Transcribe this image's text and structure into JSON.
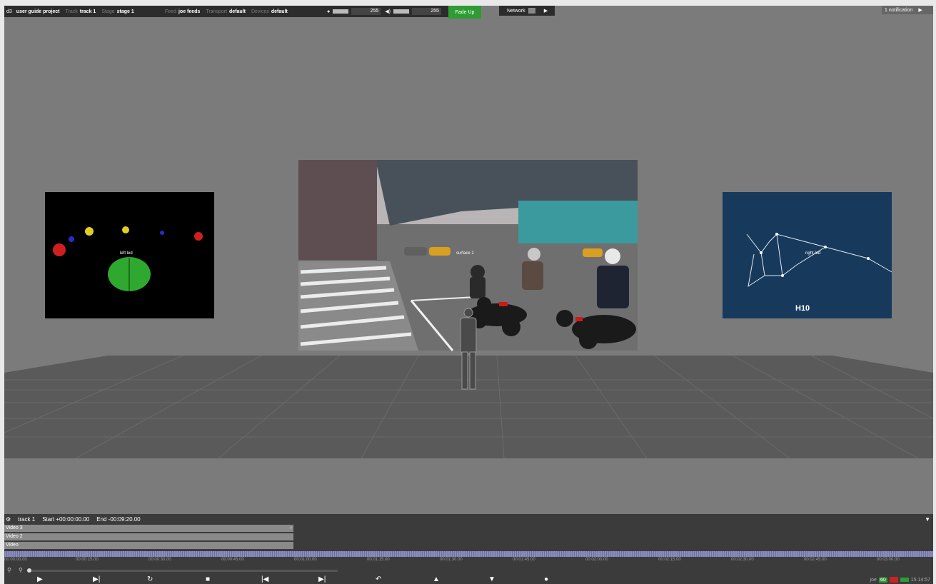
{
  "app": {
    "logo": "d3"
  },
  "topbar": {
    "project": "user guide project",
    "track_label": "Track",
    "track_value": "track 1",
    "stage_label": "Stage",
    "stage_value": "stage 1",
    "feed_label": "Feed",
    "feed_value": "joe feeds",
    "transport_label": "Transport",
    "transport_value": "default",
    "devices_label": "Devices",
    "devices_value": "default",
    "brightness_value": "255",
    "volume_value": "255",
    "fade_up": "Fade Up",
    "network": "Network",
    "notifications": "1 notification"
  },
  "stage": {
    "left_screen_label": "left led",
    "center_screen_label": "surface 1",
    "right_screen_label": "right led",
    "right_screen_caption": "H10"
  },
  "timeline": {
    "track_name": "track 1",
    "start": "Start +00:00:00.00",
    "end": "End -00:09:20.00",
    "layers": [
      "Video 3",
      "Video 2",
      "Video"
    ],
    "time_labels": [
      "00:00:00.00",
      "00:00:15.00",
      "00:00:30.00",
      "00:00:45.00",
      "00:01:00.00",
      "00:01:15.00",
      "00:01:30.00",
      "00:01:45.00",
      "00:02:00.00",
      "00:02:15.00",
      "00:02:30.00",
      "00:02:45.00",
      "00:03:00.00"
    ],
    "status_user": "joe",
    "status_fps": "60",
    "status_time": "15:14:57"
  },
  "icons": {
    "gear": "gear-icon",
    "play": "play-icon",
    "play_to_end": "play-to-end-icon",
    "stop": "stop-icon",
    "prev": "previous-icon",
    "next": "next-icon",
    "loop": "loop-icon",
    "up": "up-icon",
    "down": "down-icon",
    "record": "record-icon",
    "zoom": "zoom-icon"
  },
  "colors": {
    "fade_button": "#2e9c33",
    "ruler": "#8c8cc0"
  }
}
